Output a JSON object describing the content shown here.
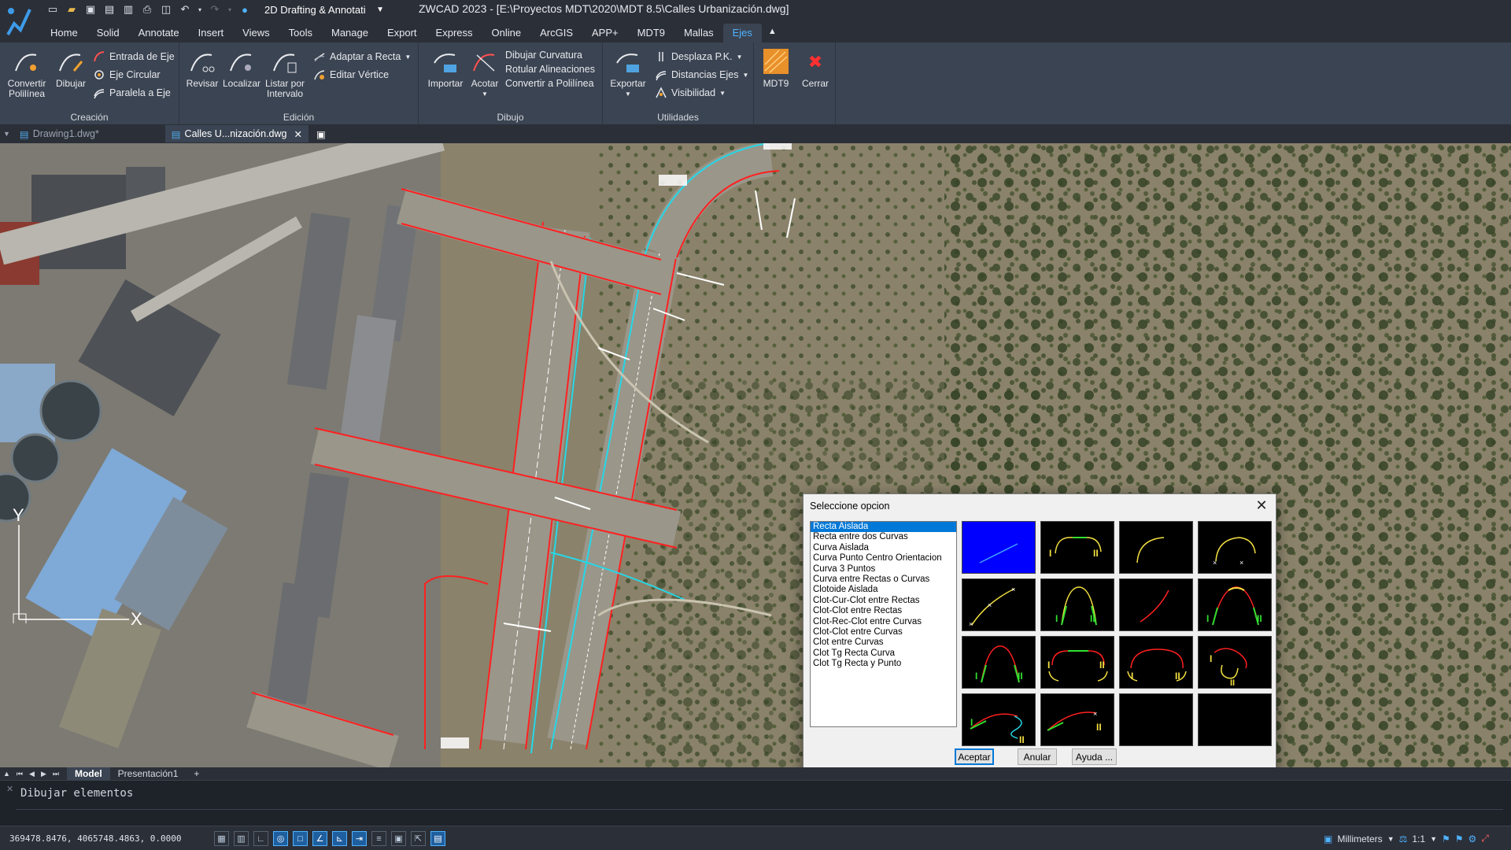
{
  "window": {
    "title": "ZWCAD 2023 - [E:\\Proyectos MDT\\2020\\MDT 8.5\\Calles Urbanización.dwg]",
    "workspace": "2D Drafting & Annotati"
  },
  "menu": {
    "tabs": [
      "Home",
      "Solid",
      "Annotate",
      "Insert",
      "Views",
      "Tools",
      "Manage",
      "Export",
      "Express",
      "Online",
      "ArcGIS",
      "APP+",
      "MDT9",
      "Mallas",
      "Ejes"
    ],
    "active": "Ejes"
  },
  "ribbon": {
    "creacion": {
      "title": "Creación",
      "convertir": "Convertir\nPolilínea",
      "dibujar": "Dibujar",
      "entrada": "Entrada de Eje",
      "circular": "Eje Circular",
      "paralela": "Paralela a Eje"
    },
    "edicion": {
      "title": "Edición",
      "revisar": "Revisar",
      "localizar": "Localizar",
      "listar": "Listar por\nIntervalo",
      "adaptar": "Adaptar a Recta",
      "editar": "Editar Vértice"
    },
    "dibujo": {
      "title": "Dibujo",
      "importar": "Importar",
      "acotar": "Acotar",
      "curvatura": "Dibujar Curvatura",
      "rotular": "Rotular Alineaciones",
      "convertir": "Convertir a Polilínea"
    },
    "utilidades": {
      "title": "Utilidades",
      "exportar": "Exportar",
      "desplaza": "Desplaza P.K.",
      "distancias": "Distancias Ejes",
      "visibilidad": "Visibilidad"
    },
    "mdt9": "MDT9",
    "cerrar": "Cerrar"
  },
  "doc_tabs": [
    {
      "label": "Drawing1.dwg*",
      "active": false
    },
    {
      "label": "Calles U...nización.dwg",
      "active": true
    }
  ],
  "canvas": {
    "ucs_y": "Y",
    "ucs_x": "X"
  },
  "layout_tabs": [
    "Model",
    "Presentación1",
    "+"
  ],
  "command_line": "Dibujar elementos",
  "status": {
    "coords": "369478.8476, 4065748.4863, 0.0000",
    "units": "Millimeters",
    "scale": "1:1"
  },
  "dialog": {
    "title": "Seleccione opcion",
    "options": [
      "Recta Aislada",
      "Recta entre dos Curvas",
      "Curva Aislada",
      "Curva Punto Centro Orientacion",
      "Curva 3 Puntos",
      "Curva entre Rectas o Curvas",
      "Clotoide Aislada",
      "Clot-Cur-Clot entre Rectas",
      "Clot-Clot entre Rectas",
      "Clot-Rec-Clot entre Curvas",
      "Clot-Clot entre Curvas",
      "Clot entre Curvas",
      "Clot Tg Recta Curva",
      "Clot Tg Recta y Punto"
    ],
    "selected_index": 0,
    "tile_labels": {
      "i": "I",
      "ii": "II"
    },
    "buttons": {
      "ok": "Aceptar",
      "cancel": "Anular",
      "help": "Ayuda ..."
    }
  },
  "colors": {
    "accent": "#4fb3ff",
    "ribbon_bg": "#3b4452",
    "selection": "#0078d7",
    "axis_red": "#ff2020",
    "axis_cyan": "#25d8e8"
  }
}
